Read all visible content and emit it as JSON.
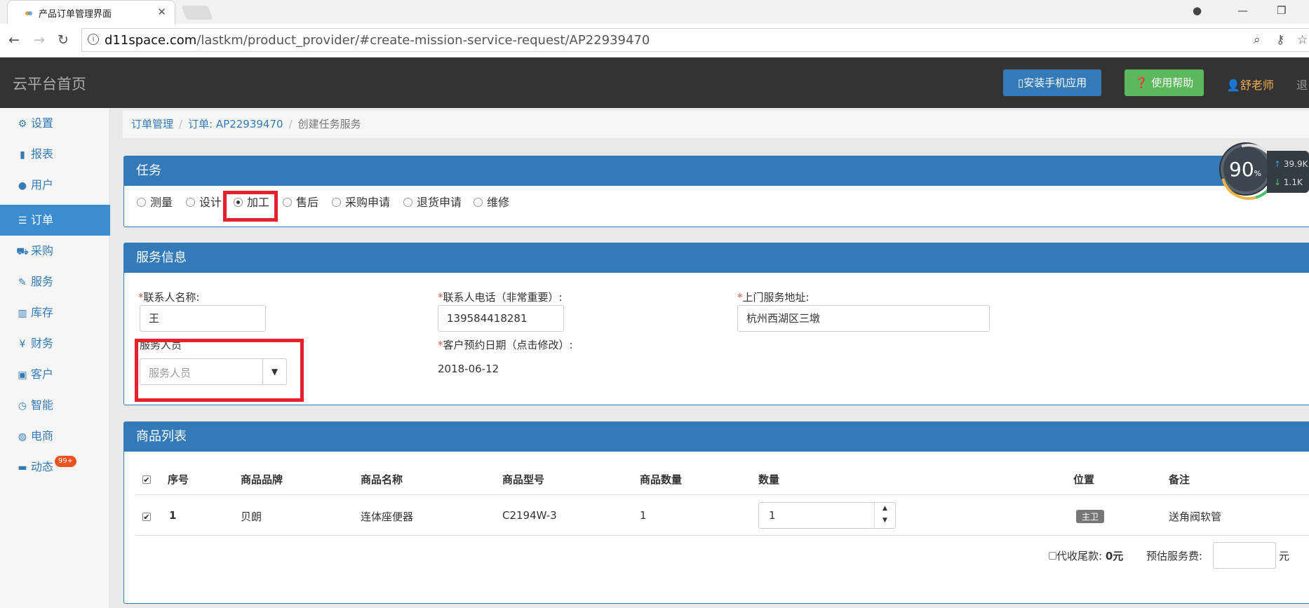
{
  "browser": {
    "tab_title": "产品订单管理界面",
    "url_host": "d11space.com",
    "url_path": "/lastkm/product_provider/#create-mission-service-request/AP22939470"
  },
  "header": {
    "brand": "云平台首页",
    "install_label": "安装手机应用",
    "help_label": "使用帮助",
    "user_name": "舒老师",
    "logout_label": "退"
  },
  "sidebar": {
    "items": [
      {
        "label": "设置",
        "icon": "gear-icon"
      },
      {
        "label": "报表",
        "icon": "bar-chart-icon"
      },
      {
        "label": "用户",
        "icon": "user-icon"
      },
      {
        "label": "订单",
        "icon": "list-icon"
      },
      {
        "label": "采购",
        "icon": "cart-icon"
      },
      {
        "label": "服务",
        "icon": "wrench-icon"
      },
      {
        "label": "库存",
        "icon": "barcode-icon"
      },
      {
        "label": "财务",
        "icon": "yen-icon"
      },
      {
        "label": "客户",
        "icon": "briefcase-icon"
      },
      {
        "label": "智能",
        "icon": "clock-icon"
      },
      {
        "label": "电商",
        "icon": "globe-icon"
      },
      {
        "label": "动态",
        "icon": "comment-icon",
        "badge": "99+"
      }
    ],
    "active_index": 3
  },
  "breadcrumb": {
    "level1": "订单管理",
    "level2": "订单: AP22939470",
    "current": "创建任务服务"
  },
  "task_panel": {
    "title": "任务",
    "options": [
      "测量",
      "设计",
      "加工",
      "售后",
      "采购申请",
      "退货申请",
      "维修"
    ],
    "selected": "加工"
  },
  "service_panel": {
    "title": "服务信息",
    "contact_name_label": "联系人名称:",
    "contact_name_value": "王",
    "contact_phone_label": "联系人电话（非常重要）:",
    "contact_phone_value": "139584418281",
    "address_label": "上门服务地址:",
    "address_value": "杭州西湖区三墩",
    "staff_label": "服务人员",
    "staff_placeholder": "服务人员",
    "date_label": "客户预约日期（点击修改）:",
    "date_value": "2018-06-12",
    "required_mark": "*"
  },
  "goods_panel": {
    "title": "商品列表",
    "columns": [
      "序号",
      "商品品牌",
      "商品名称",
      "商品型号",
      "商品数量",
      "数量",
      "位置",
      "备注"
    ],
    "rows": [
      {
        "index": "1",
        "brand": "贝朗",
        "name": "连体座便器",
        "model": "C2194W-3",
        "count": "1",
        "quantity": "1",
        "location": "主卫",
        "note": "送角阀软管"
      }
    ],
    "collect_label": "代收尾款:",
    "collect_value": "0元",
    "fee_label": "预估服务费:",
    "fee_unit": "元"
  },
  "speed_widget": {
    "percent": "90",
    "percent_unit": "%",
    "up_rate": "39.9K",
    "down_rate": "1.1K"
  }
}
